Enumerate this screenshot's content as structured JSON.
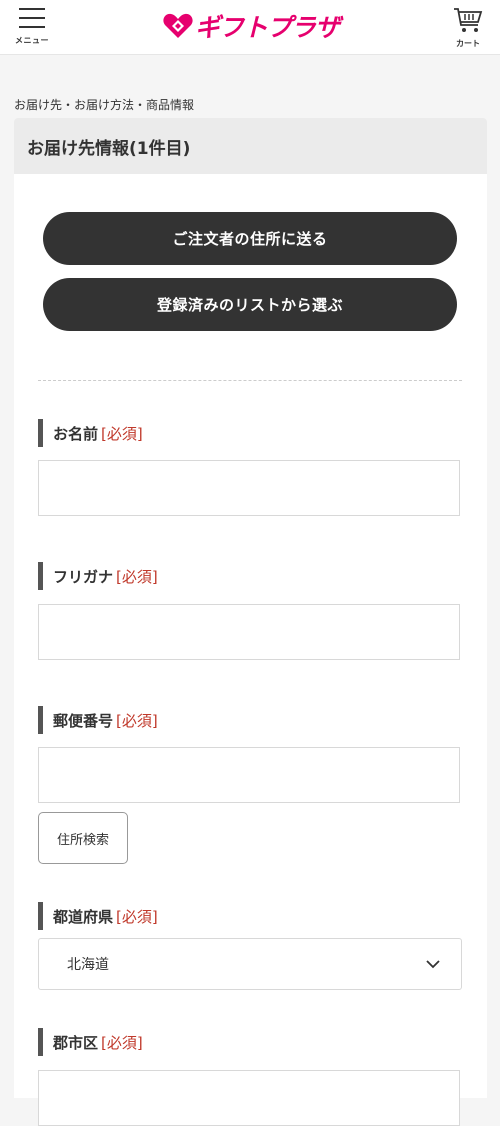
{
  "header": {
    "menu_label": "メニュー",
    "logo_text": "ギフトプラザ",
    "cart_label": "カート",
    "brand_color": "#e6006e"
  },
  "breadcrumb": "お届け先・お届け方法・商品情報",
  "section": {
    "title": "お届け先情報(1件目)",
    "button_orderer_address": "ご注文者の住所に送る",
    "button_from_list": "登録済みのリストから選ぶ"
  },
  "form": {
    "required_mark": "[必須]",
    "name_label": "お名前",
    "name_value": "",
    "furigana_label": "フリガナ",
    "furigana_value": "",
    "postal_label": "郵便番号",
    "postal_value": "",
    "address_search_button": "住所検索",
    "prefecture_label": "都道府県",
    "prefecture_value": "北海道",
    "city_label": "郡市区",
    "city_value": ""
  },
  "icons": {
    "menu": "hamburger-icon",
    "logo": "heart-logo-icon",
    "cart": "cart-icon",
    "select": "chevron-down-icon"
  }
}
